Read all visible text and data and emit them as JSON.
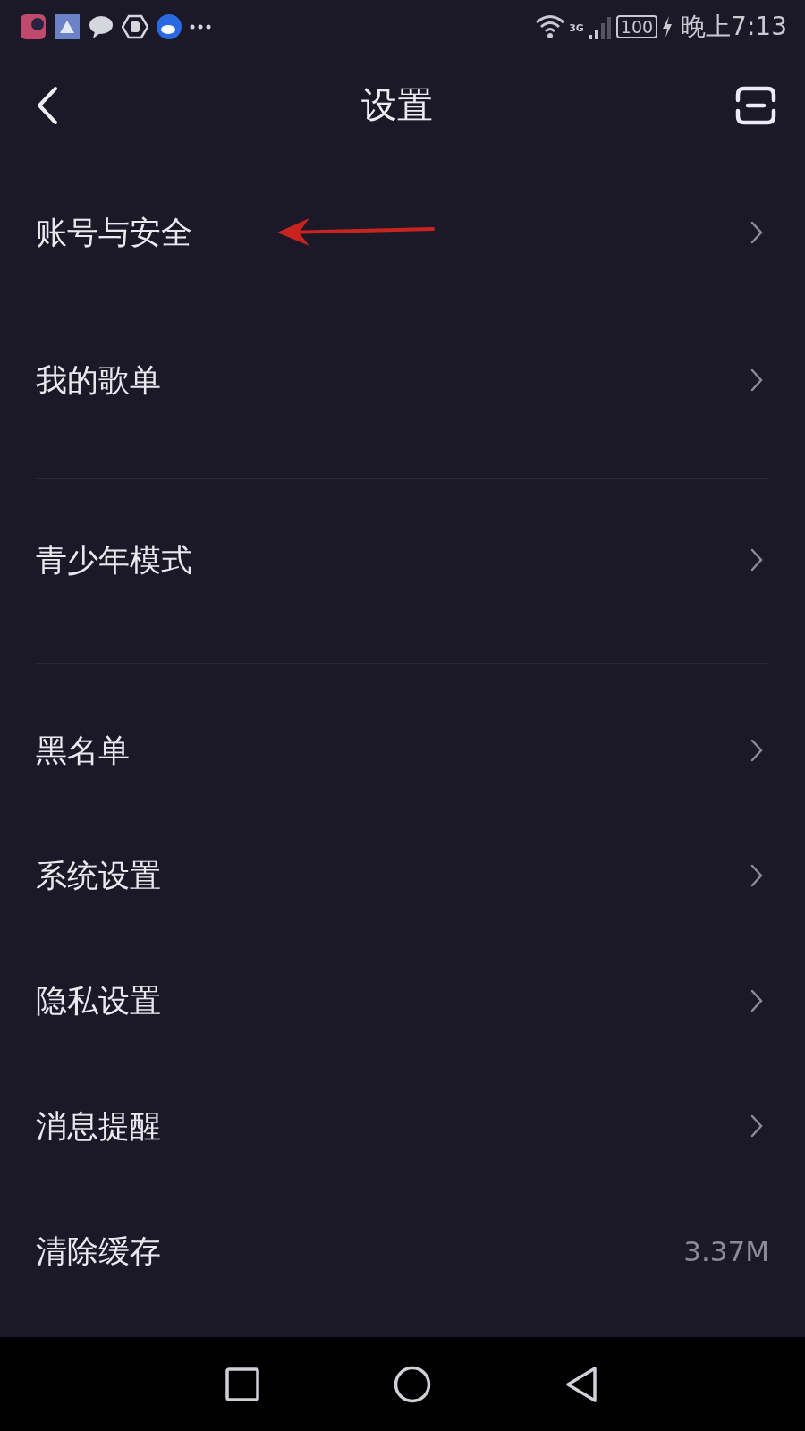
{
  "status_bar": {
    "network": "3G",
    "battery": "100",
    "time": "晚上7:13"
  },
  "header": {
    "title": "设置"
  },
  "sections": [
    {
      "items": [
        {
          "label": "账号与安全",
          "kind": "link",
          "annotated": true
        },
        {
          "label": "我的歌单",
          "kind": "link",
          "annotated": false
        }
      ]
    },
    {
      "items": [
        {
          "label": "青少年模式",
          "kind": "link",
          "annotated": false
        }
      ]
    },
    {
      "items": [
        {
          "label": "黑名单",
          "kind": "link",
          "annotated": false
        },
        {
          "label": "系统设置",
          "kind": "link",
          "annotated": false
        },
        {
          "label": "隐私设置",
          "kind": "link",
          "annotated": false
        },
        {
          "label": "消息提醒",
          "kind": "link",
          "annotated": false
        },
        {
          "label": "清除缓存",
          "kind": "value",
          "value": "3.37M",
          "annotated": false
        }
      ]
    }
  ]
}
